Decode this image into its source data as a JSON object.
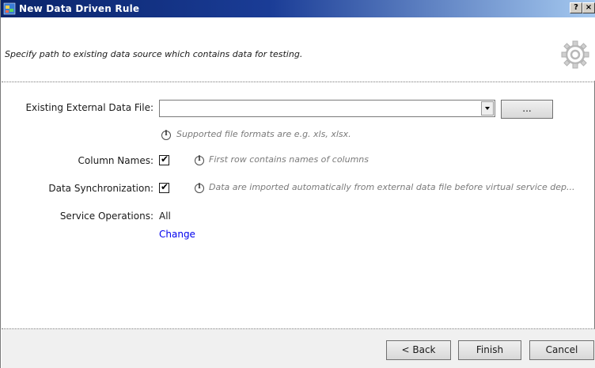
{
  "window": {
    "title": "New Data Driven Rule",
    "help_label": "?",
    "close_label": "×"
  },
  "header": {
    "description": "Specify path to existing data source which contains data for testing."
  },
  "form": {
    "data_file": {
      "label": "Existing External Data File:",
      "value": "",
      "browse_label": "...",
      "hint": "Supported file formats are e.g. xls, xlsx."
    },
    "column_names": {
      "label": "Column Names:",
      "checked": true,
      "hint": "First row contains names of columns"
    },
    "data_sync": {
      "label": "Data Synchronization:",
      "checked": true,
      "hint": "Data are imported automatically from external data file before virtual service dep..."
    },
    "service_operations": {
      "label": "Service Operations:",
      "value": "All",
      "change_link": "Change"
    }
  },
  "footer": {
    "back_label": "< Back",
    "finish_label": "Finish",
    "cancel_label": "Cancel"
  },
  "colors": {
    "title_bar": "#0a246a",
    "link": "#0000ee",
    "hint_text": "#7a7a7a"
  },
  "icons": {
    "app": "app-icon",
    "header": "gear-icon",
    "info": "info-icon",
    "dropdown": "chevron-down-icon"
  }
}
